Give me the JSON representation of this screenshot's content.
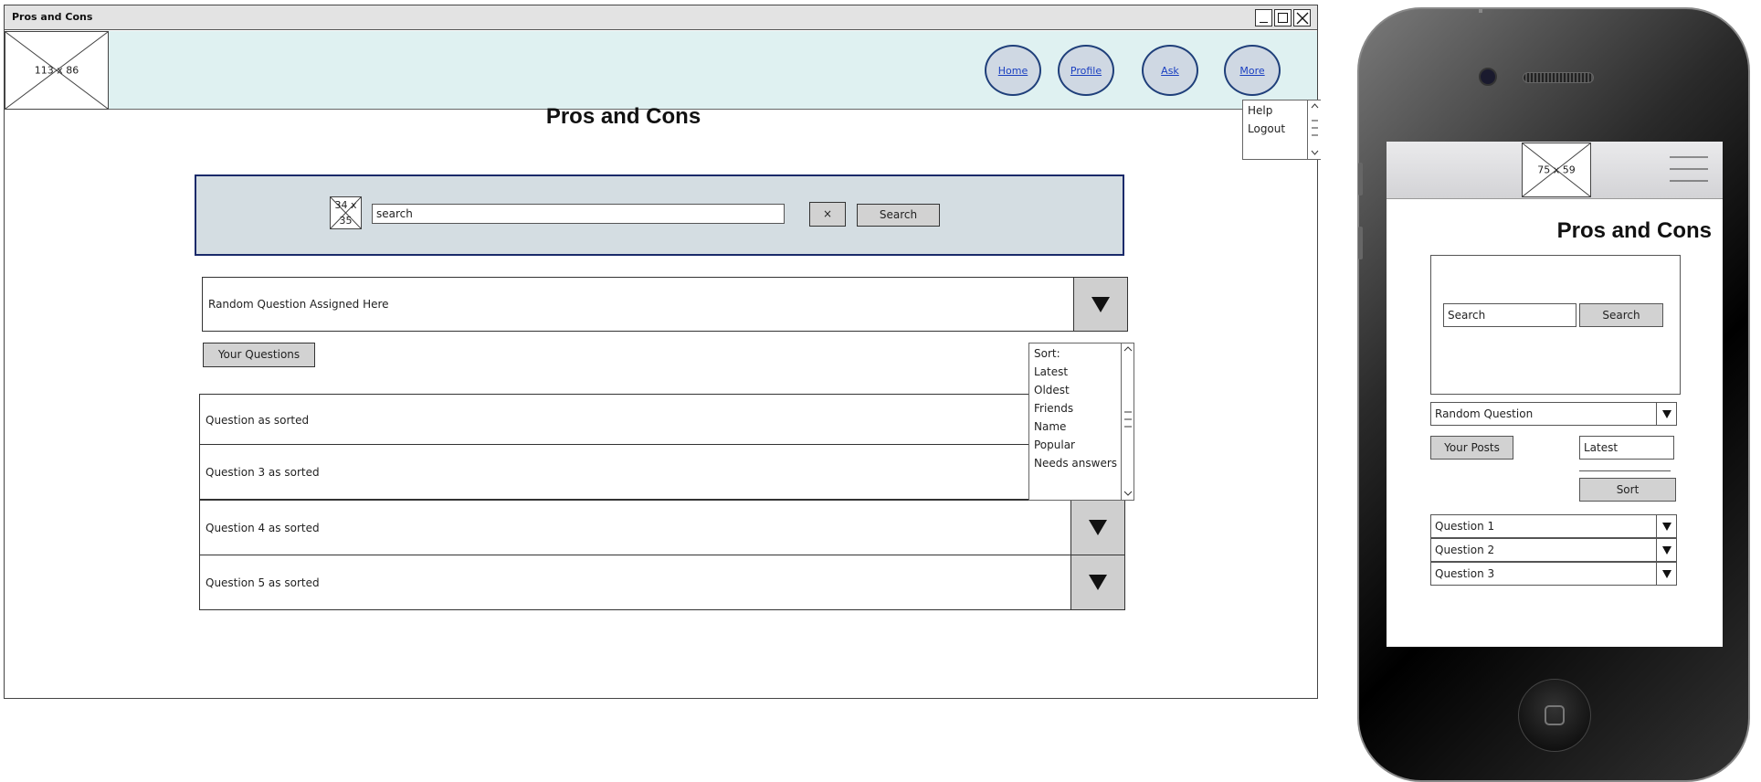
{
  "window": {
    "title": "Pros and Cons",
    "logo_placeholder": "113 x 86",
    "nav": [
      {
        "label": "Home"
      },
      {
        "label": "Profile"
      },
      {
        "label": "Ask"
      },
      {
        "label": "More"
      }
    ],
    "more_menu": [
      "Help",
      "Logout"
    ],
    "page_title": "Pros and Cons",
    "search": {
      "icon_placeholder_top": "34 x",
      "icon_placeholder_bottom": "35",
      "value": "search",
      "clear_label": "×",
      "button_label": "Search"
    },
    "random_question": "Random Question Assigned Here",
    "your_questions_label": "Your Questions",
    "sort_menu": [
      "Sort:",
      "Latest",
      "Oldest",
      "Friends",
      "Name",
      "Popular",
      "Needs answers"
    ],
    "questions": [
      {
        "label": "Question as sorted"
      },
      {
        "label": "Question 3 as sorted"
      },
      {
        "label": "Question 4 as sorted"
      },
      {
        "label": "Question 5 as sorted"
      }
    ]
  },
  "mobile": {
    "logo_placeholder": "75 x 59",
    "page_title": "Pros and Cons",
    "search_placeholder": "Search",
    "search_button": "Search",
    "random_question": "Random Question",
    "your_posts": "Your Posts",
    "sort_value": "Latest",
    "sort_button": "Sort",
    "questions": [
      "Question 1",
      "Question 2",
      "Question 3"
    ]
  }
}
